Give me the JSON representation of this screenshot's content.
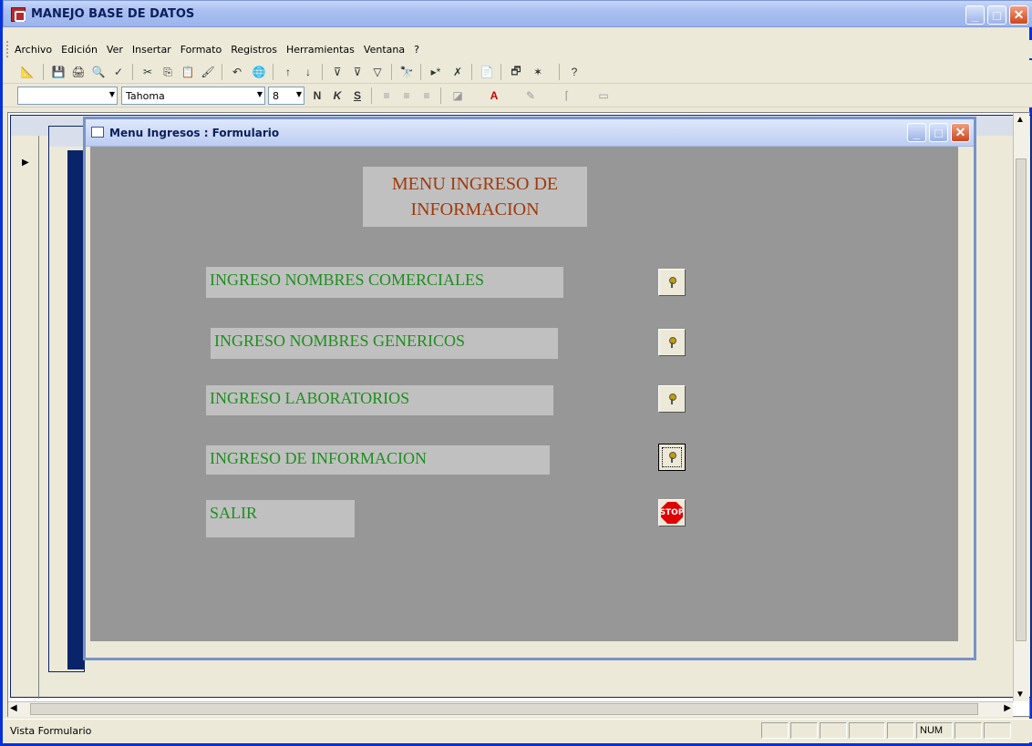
{
  "app": {
    "title": "MANEJO BASE DE DATOS"
  },
  "menu": [
    "Archivo",
    "Edición",
    "Ver",
    "Insertar",
    "Formato",
    "Registros",
    "Herramientas",
    "Ventana",
    "?"
  ],
  "format_toolbar": {
    "object_combo": "",
    "font_combo": "Tahoma",
    "size_combo": "8",
    "bold": "N",
    "italic": "K",
    "underline": "S"
  },
  "form_window": {
    "title": "Menu Ingresos : Formulario"
  },
  "form": {
    "heading": "MENU INGRESO DE INFORMACION",
    "items": [
      {
        "label": "INGRESO NOMBRES COMERCIALES",
        "button_icon": "key-icon"
      },
      {
        "label": "INGRESO NOMBRES GENERICOS",
        "button_icon": "key-icon"
      },
      {
        "label": "INGRESO LABORATORIOS",
        "button_icon": "key-icon"
      },
      {
        "label": "INGRESO DE INFORMACION",
        "button_icon": "key-icon"
      },
      {
        "label": "SALIR",
        "button_icon": "stop-icon",
        "button_text": "STOP"
      }
    ]
  },
  "statusbar": {
    "text": "Vista Formulario",
    "num": "NUM"
  },
  "colors": {
    "heading_text": "#a03a0b",
    "label_text": "#1e8f1e",
    "detail_bg": "#979797",
    "label_bg": "#c0c0c0"
  }
}
